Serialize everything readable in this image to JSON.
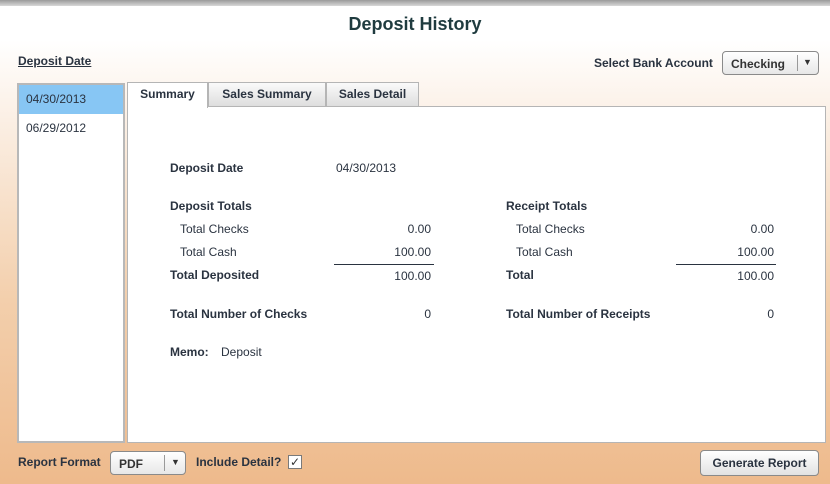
{
  "title": "Deposit History",
  "deposit_date_label": "Deposit Date",
  "bank": {
    "label": "Select Bank Account",
    "value": "Checking"
  },
  "dates": [
    "04/30/2013",
    "06/29/2012"
  ],
  "tabs": [
    "Summary",
    "Sales Summary",
    "Sales Detail"
  ],
  "summary": {
    "deposit_date_label": "Deposit Date",
    "deposit_date_value": "04/30/2013",
    "deposit_totals": {
      "heading": "Deposit Totals",
      "checks_label": "Total Checks",
      "checks_value": "0.00",
      "cash_label": "Total Cash",
      "cash_value": "100.00",
      "total_label": "Total Deposited",
      "total_value": "100.00",
      "count_label": "Total Number of Checks",
      "count_value": "0"
    },
    "receipt_totals": {
      "heading": "Receipt Totals",
      "checks_label": "Total Checks",
      "checks_value": "0.00",
      "cash_label": "Total Cash",
      "cash_value": "100.00",
      "total_label": "Total",
      "total_value": "100.00",
      "count_label": "Total Number of Receipts",
      "count_value": "0"
    },
    "memo_label": "Memo:",
    "memo_value": "Deposit"
  },
  "footer": {
    "format_label": "Report Format",
    "format_value": "PDF",
    "include_detail_label": "Include Detail?",
    "include_detail_checked": "✓",
    "generate_button": "Generate Report"
  }
}
